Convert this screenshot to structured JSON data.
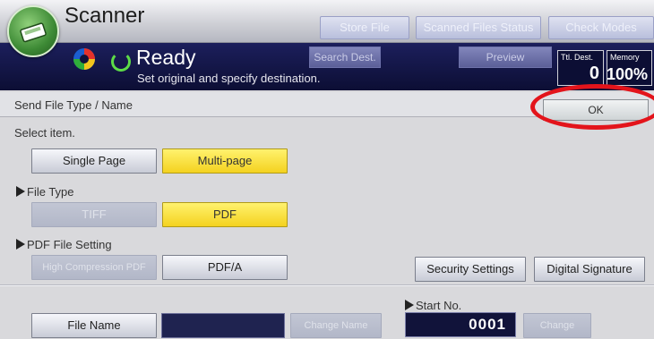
{
  "title_bar": {
    "app_title": "Scanner",
    "buttons": [
      {
        "label": "Store File"
      },
      {
        "label": "Scanned Files Status"
      },
      {
        "label": "Check Modes"
      }
    ]
  },
  "status_bar": {
    "state": "Ready",
    "message": "Set original and specify destination.",
    "search_dest_label": "Search Dest.",
    "preview_label": "Preview",
    "total_dest": {
      "label": "Ttl. Dest.",
      "value": "0"
    },
    "memory": {
      "label": "Memory",
      "value": "100%"
    }
  },
  "header": {
    "title": "Send File Type / Name",
    "ok_label": "OK"
  },
  "select_item": {
    "label": "Select item.",
    "options": [
      {
        "label": "Single Page",
        "selected": false
      },
      {
        "label": "Multi-page",
        "selected": true
      }
    ]
  },
  "file_type": {
    "label": "File Type",
    "options": [
      {
        "label": "TIFF",
        "selected": false,
        "enabled": false
      },
      {
        "label": "PDF",
        "selected": true,
        "enabled": true
      }
    ]
  },
  "pdf_setting": {
    "label": "PDF File Setting",
    "options": [
      {
        "label": "High Compression PDF",
        "enabled": false
      },
      {
        "label": "PDF/A",
        "enabled": true
      }
    ],
    "security_settings_label": "Security Settings",
    "digital_signature_label": "Digital Signature"
  },
  "file_name": {
    "label": "File Name",
    "value": "",
    "change_label": "Change Name"
  },
  "start_no": {
    "label": "Start No.",
    "value": "0001",
    "change_label": "Change"
  },
  "colors": {
    "status_bar": "#141752",
    "selected": "#f7db2e",
    "highlight_ring": "#e3141b",
    "ready_icon": "#5ddc47"
  }
}
